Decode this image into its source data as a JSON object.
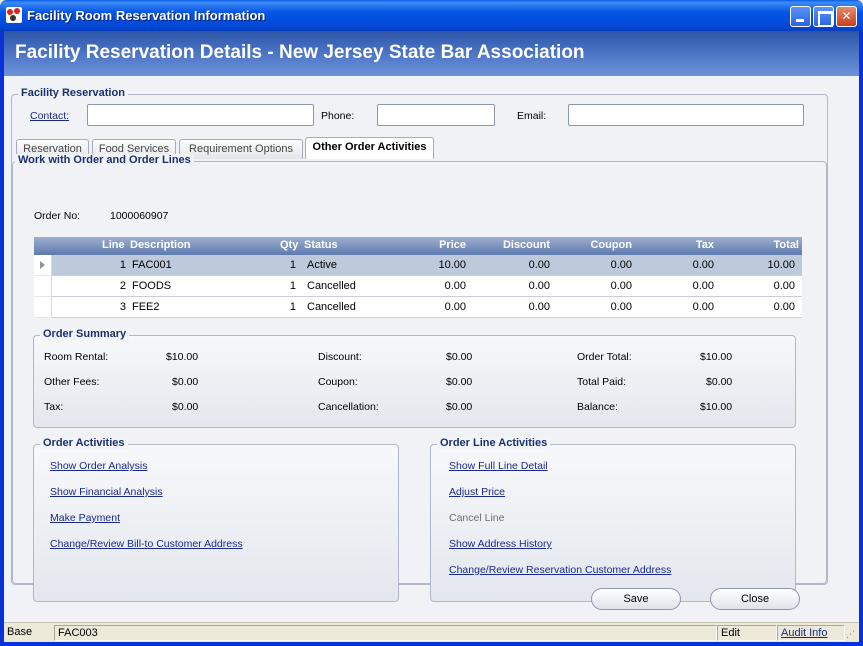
{
  "window": {
    "title": "Facility Room Reservation Information"
  },
  "banner": {
    "title": "Facility Reservation Details - New Jersey State Bar Association"
  },
  "facility": {
    "group_title": "Facility Reservation",
    "contact_label": "Contact:",
    "phone_label": "Phone:",
    "email_label": "Email:",
    "contact_value": "",
    "phone_value": "",
    "email_value": ""
  },
  "tabs": [
    {
      "label": "Reservation"
    },
    {
      "label": "Food Services"
    },
    {
      "label": "Requirement Options"
    },
    {
      "label": "Other Order Activities"
    }
  ],
  "work": {
    "group_title": "Work with Order and Order Lines",
    "order_no_label": "Order No:",
    "order_no_value": "1000060907"
  },
  "grid": {
    "columns": [
      "Line",
      "Description",
      "Qty",
      "Status",
      "Price",
      "Discount",
      "Coupon",
      "Tax",
      "Total"
    ],
    "rows": [
      {
        "line": "1",
        "description": "FAC001",
        "qty": "1",
        "status": "Active",
        "price": "10.00",
        "discount": "0.00",
        "coupon": "0.00",
        "tax": "0.00",
        "total": "10.00"
      },
      {
        "line": "2",
        "description": "FOODS",
        "qty": "1",
        "status": "Cancelled",
        "price": "0.00",
        "discount": "0.00",
        "coupon": "0.00",
        "tax": "0.00",
        "total": "0.00"
      },
      {
        "line": "3",
        "description": "FEE2",
        "qty": "1",
        "status": "Cancelled",
        "price": "0.00",
        "discount": "0.00",
        "coupon": "0.00",
        "tax": "0.00",
        "total": "0.00"
      }
    ]
  },
  "summary": {
    "group_title": "Order Summary",
    "room_rental_label": "Room Rental:",
    "room_rental_value": "$10.00",
    "other_fees_label": "Other Fees:",
    "other_fees_value": "$0.00",
    "tax_label": "Tax:",
    "tax_value": "$0.00",
    "discount_label": "Discount:",
    "discount_value": "$0.00",
    "coupon_label": "Coupon:",
    "coupon_value": "$0.00",
    "cancellation_label": "Cancellation:",
    "cancellation_value": "$0.00",
    "order_total_label": "Order Total:",
    "order_total_value": "$10.00",
    "total_paid_label": "Total Paid:",
    "total_paid_value": "$0.00",
    "balance_label": "Balance:",
    "balance_value": "$10.00"
  },
  "order_activities": {
    "group_title": "Order Activities",
    "links": [
      "Show Order Analysis",
      "Show Financial Analysis",
      "Make Payment",
      "Change/Review Bill-to Customer Address"
    ]
  },
  "line_activities": {
    "group_title": "Order Line Activities",
    "items": [
      "Show Full Line Detail",
      "Adjust Price",
      "Cancel Line",
      "Show Address History",
      "Change/Review Reservation Customer Address"
    ]
  },
  "buttons": {
    "save": "Save",
    "close": "Close"
  },
  "statusbar": {
    "mode": "Base",
    "code": "FAC003",
    "state": "Edit",
    "audit": "Audit Info"
  }
}
